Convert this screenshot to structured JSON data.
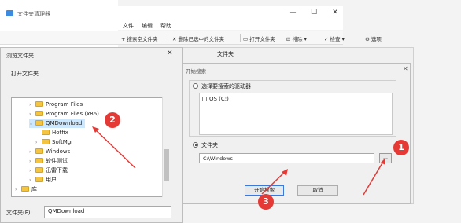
{
  "main_window": {
    "title": "文件夹清理器",
    "controls": {
      "minimize": "—",
      "maximize": "☐",
      "close": "✕"
    },
    "menu": [
      "文件",
      "编辑",
      "帮助"
    ],
    "toolbar": [
      {
        "icon": "plus-icon",
        "label": "搜索空文件夹"
      },
      {
        "icon": "delete-icon",
        "label": "删除已选中的文件夹"
      },
      {
        "icon": "folder-open-icon",
        "label": "打开文件夹"
      },
      {
        "icon": "exclude-icon",
        "label": "排除"
      },
      {
        "icon": "check-icon",
        "label": "检查"
      },
      {
        "icon": "gear-icon",
        "label": "选项"
      }
    ]
  },
  "browse_dialog": {
    "title": "浏览文件夹",
    "close": "✕",
    "description": "打开文件夹",
    "tree": [
      {
        "label": "Program Files",
        "expanded": false,
        "selected": false
      },
      {
        "label": "Program Files (x86)",
        "expanded": false,
        "selected": false
      },
      {
        "label": "QMDownload",
        "expanded": true,
        "selected": true
      },
      {
        "label": "Hotfix",
        "expanded": false,
        "selected": false
      },
      {
        "label": "SoftMgr",
        "expanded": false,
        "selected": false
      },
      {
        "label": "Windows",
        "expanded": false,
        "selected": false
      },
      {
        "label": "软件测试",
        "expanded": false,
        "selected": false
      },
      {
        "label": "迅雷下载",
        "expanded": false,
        "selected": false
      },
      {
        "label": "用户",
        "expanded": false,
        "selected": false
      },
      {
        "label": "库",
        "expanded": false,
        "selected": false
      }
    ],
    "folder_label": "文件夹(F):",
    "folder_value": "QMDownload"
  },
  "settings_panel": {
    "label": "文件夹",
    "dialog_title": "开始搜索",
    "dialog_close": "✕",
    "option_drives": "选择要搜索的驱动器",
    "drive_item": "OS (C:)",
    "option_folder": "文件夹",
    "folder_path": "C:\\Windows",
    "browse_button": "...",
    "start_button": "开始搜索",
    "cancel_button": "取消"
  },
  "annotations": {
    "badge_1": "1",
    "badge_2": "2",
    "badge_3": "3",
    "color": "#e53935"
  }
}
